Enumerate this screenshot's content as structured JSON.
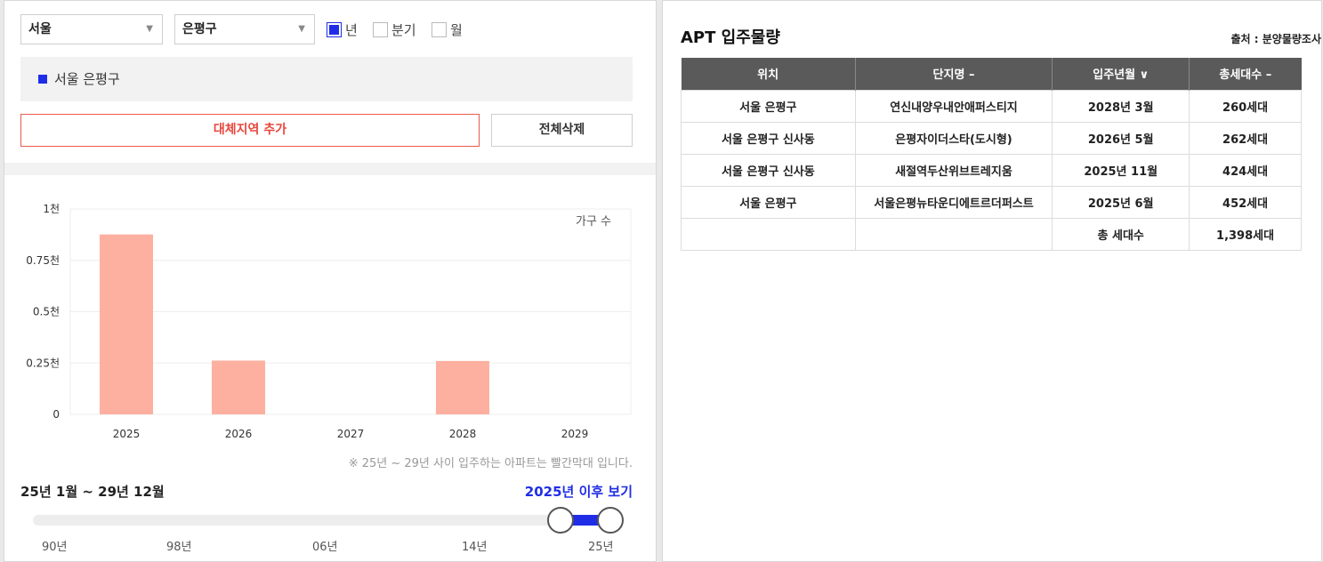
{
  "filters": {
    "city": "서울",
    "district": "은평구",
    "period_options": [
      {
        "label": "년",
        "checked": true
      },
      {
        "label": "분기",
        "checked": false
      },
      {
        "label": "월",
        "checked": false
      }
    ]
  },
  "region": {
    "selected": "서울 은평구",
    "marker_color": "#1f2ee6"
  },
  "buttons": {
    "add_region": "대체지역 추가",
    "delete_all": "전체삭제"
  },
  "chart_data": {
    "type": "bar",
    "categories": [
      "2025",
      "2026",
      "2027",
      "2028",
      "2029"
    ],
    "values": [
      876,
      262,
      0,
      260,
      0
    ],
    "y_ticks": [
      {
        "value": 0,
        "label": "0"
      },
      {
        "value": 250,
        "label": "0.25천"
      },
      {
        "value": 500,
        "label": "0.5천"
      },
      {
        "value": 750,
        "label": "0.75천"
      },
      {
        "value": 1000,
        "label": "1천"
      }
    ],
    "ylim": [
      0,
      1000
    ],
    "legend": "가구 수",
    "bar_color": "#fdb0a0",
    "grid": true
  },
  "note": "※ 25년 ~ 29년 사이 입주하는 아파트는 빨간막대 입니다.",
  "range_label": "25년 1월 ~ 29년 12월",
  "after_link": "2025년 이후 보기",
  "slider": {
    "ticks": [
      "90년",
      "98년",
      "06년",
      "14년",
      "25년"
    ],
    "accent": "#1f2ee6"
  },
  "apt": {
    "title": "APT 입주물량",
    "source": "출처 : 분양물량조사",
    "headers": [
      "위치",
      "단지명 –",
      "입주년월 ∨",
      "총세대수 –"
    ],
    "rows": [
      [
        "서울 은평구",
        "연신내양우내안애퍼스티지",
        "2028년 3월",
        "260세대"
      ],
      [
        "서울 은평구 신사동",
        "은평자이더스타(도시형)",
        "2026년 5월",
        "262세대"
      ],
      [
        "서울 은평구 신사동",
        "새절역두산위브트레지움",
        "2025년 11월",
        "424세대"
      ],
      [
        "서울 은평구",
        "서울은평뉴타운디에트르더퍼스트",
        "2025년 6월",
        "452세대"
      ]
    ],
    "total": {
      "label": "총 세대수",
      "value": "1,398세대"
    }
  }
}
